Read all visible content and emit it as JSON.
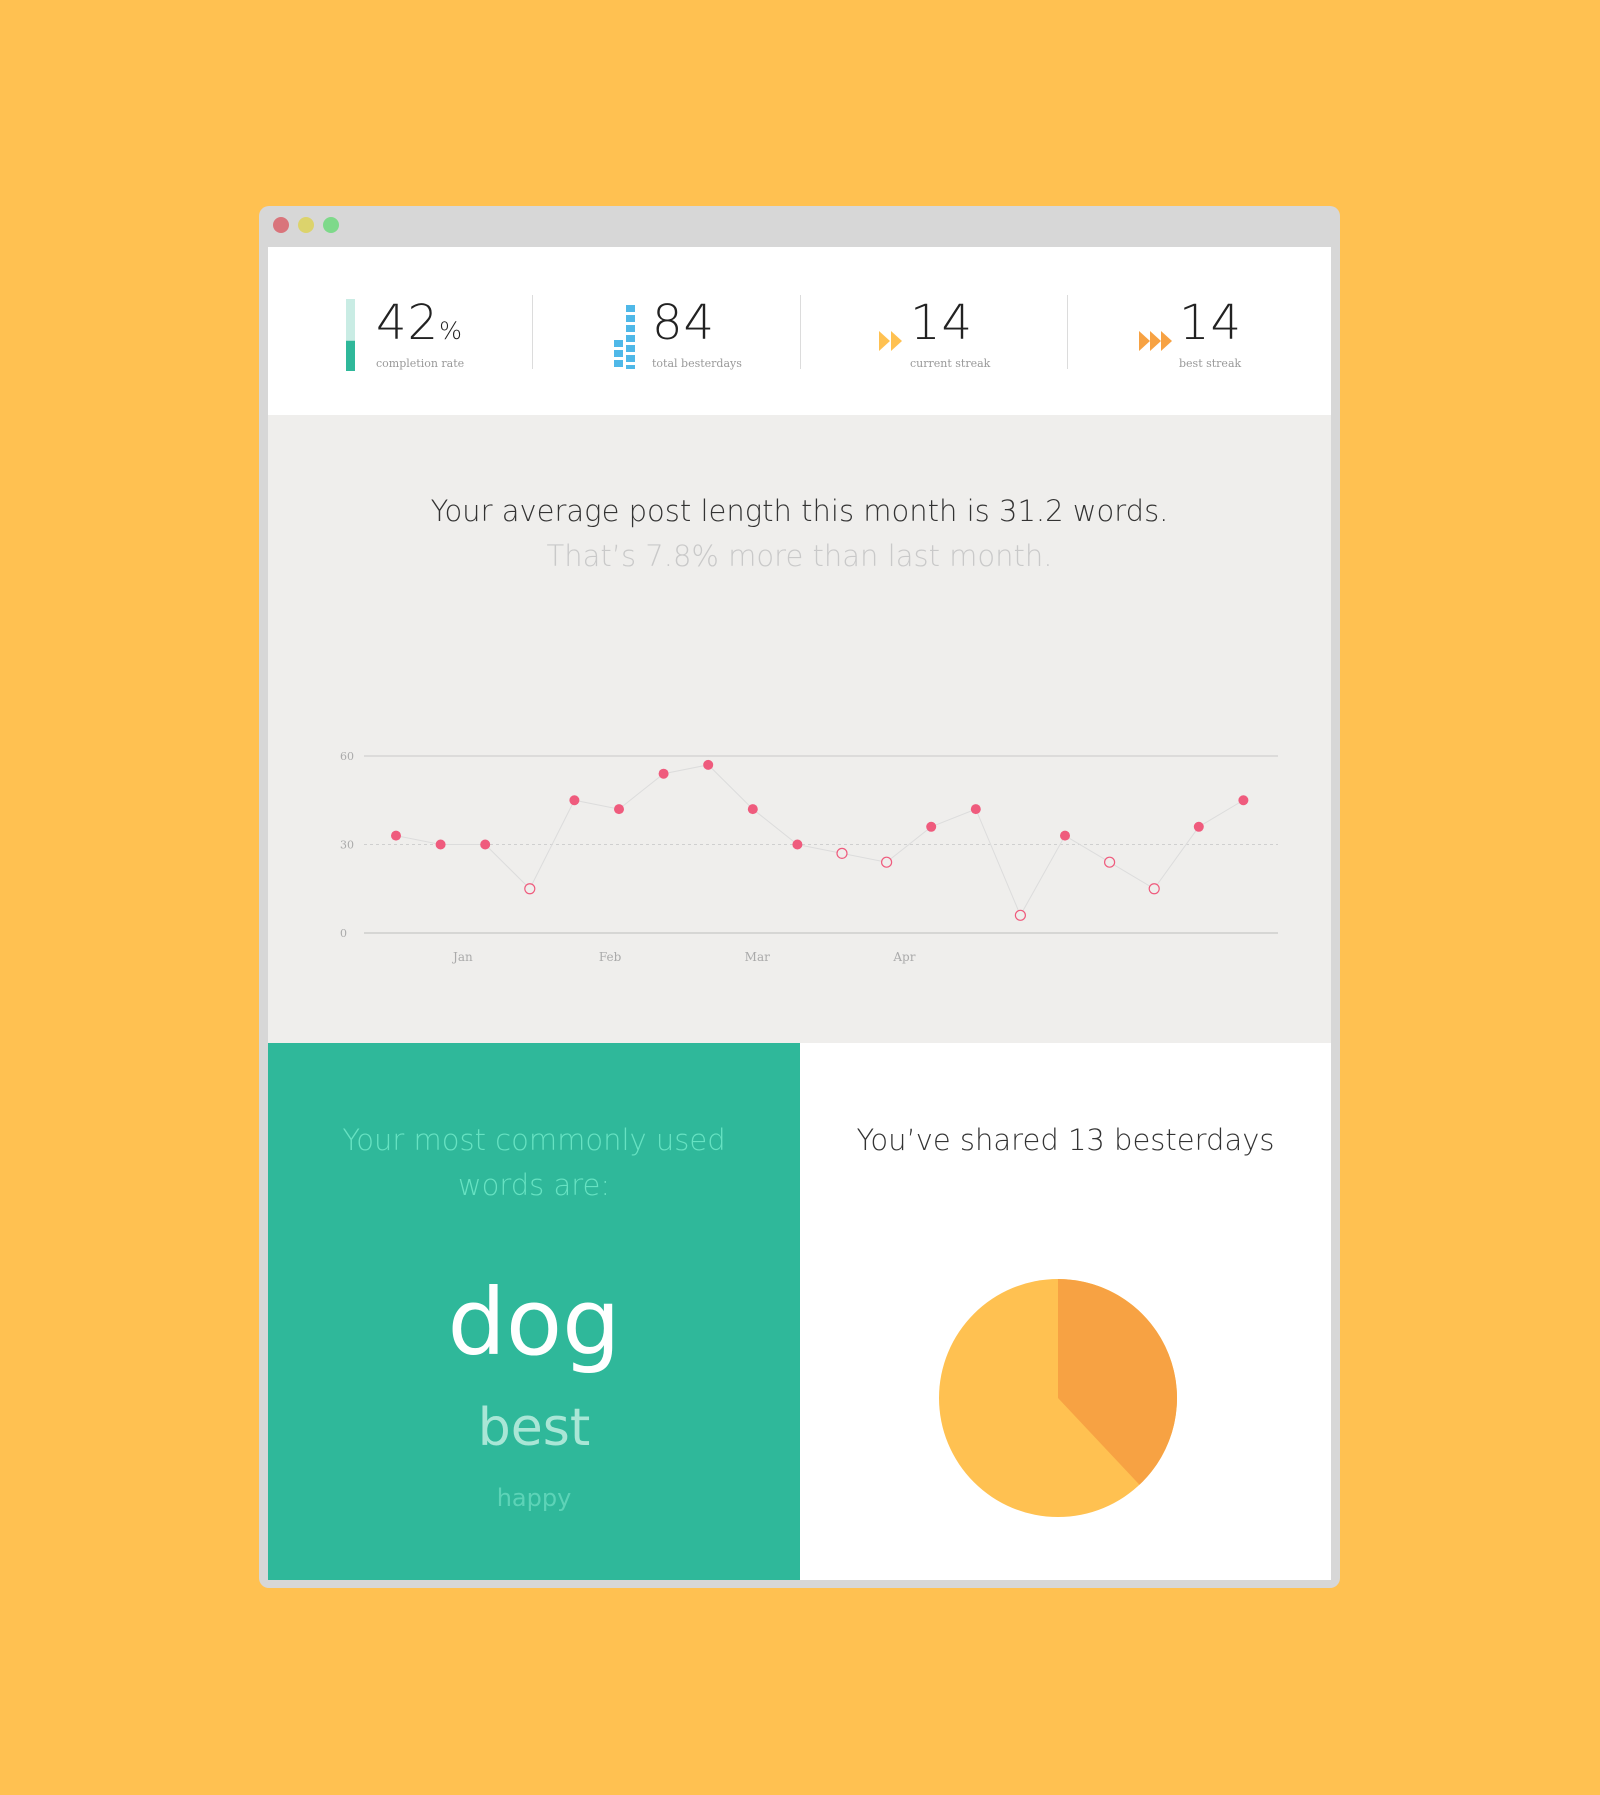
{
  "stats": {
    "completion": {
      "value": "42",
      "unit": "%",
      "label": "completion rate",
      "fraction": 0.42
    },
    "total": {
      "value": "84",
      "label": "total besterdays"
    },
    "current": {
      "value": "14",
      "label": "current streak"
    },
    "best": {
      "value": "14",
      "label": "best streak"
    }
  },
  "headline": "Your average post length this month is 31.2 words.",
  "subline": "That’s 7.8% more than last month.",
  "chart_data": {
    "type": "scatter",
    "title": "",
    "xlabel": "",
    "ylabel": "",
    "ylim": [
      0,
      60
    ],
    "yticks": [
      "0",
      "30",
      "60"
    ],
    "xticks": [
      "Jan",
      "Feb",
      "Mar",
      "Apr"
    ],
    "reference_line": 30,
    "points": [
      {
        "y": 33,
        "filled": true
      },
      {
        "y": 30,
        "filled": true
      },
      {
        "y": 30,
        "filled": true
      },
      {
        "y": 15,
        "filled": false
      },
      {
        "y": 45,
        "filled": true
      },
      {
        "y": 42,
        "filled": true
      },
      {
        "y": 54,
        "filled": true
      },
      {
        "y": 57,
        "filled": true
      },
      {
        "y": 42,
        "filled": true
      },
      {
        "y": 30,
        "filled": true
      },
      {
        "y": 27,
        "filled": false
      },
      {
        "y": 24,
        "filled": false
      },
      {
        "y": 36,
        "filled": true
      },
      {
        "y": 42,
        "filled": true
      },
      {
        "y": 6,
        "filled": false
      },
      {
        "y": 33,
        "filled": true
      },
      {
        "y": 24,
        "filled": false
      },
      {
        "y": 15,
        "filled": false
      },
      {
        "y": 36,
        "filled": true
      },
      {
        "y": 45,
        "filled": true
      }
    ],
    "colors": {
      "point": "#ef5b7d",
      "line": "#dcdcdc",
      "axis": "#c8c8c8"
    }
  },
  "words": {
    "title": "Your most commonly used words are:",
    "items": [
      "dog",
      "best",
      "happy"
    ]
  },
  "share": {
    "title": "You’ve shared 13 besterdays",
    "pie": {
      "type": "pie",
      "shared_fraction": 0.38,
      "colors": {
        "shared": "#F7A243",
        "rest": "#FFC151"
      }
    }
  },
  "colors": {
    "background": "#FFC151",
    "accent_green": "#2fb89a",
    "accent_blue": "#4fb8e8",
    "accent_orange": "#F7A243"
  },
  "icons": [
    "completion-bar-icon",
    "stacked-bars-icon",
    "fast-forward-icon",
    "triple-forward-icon"
  ]
}
